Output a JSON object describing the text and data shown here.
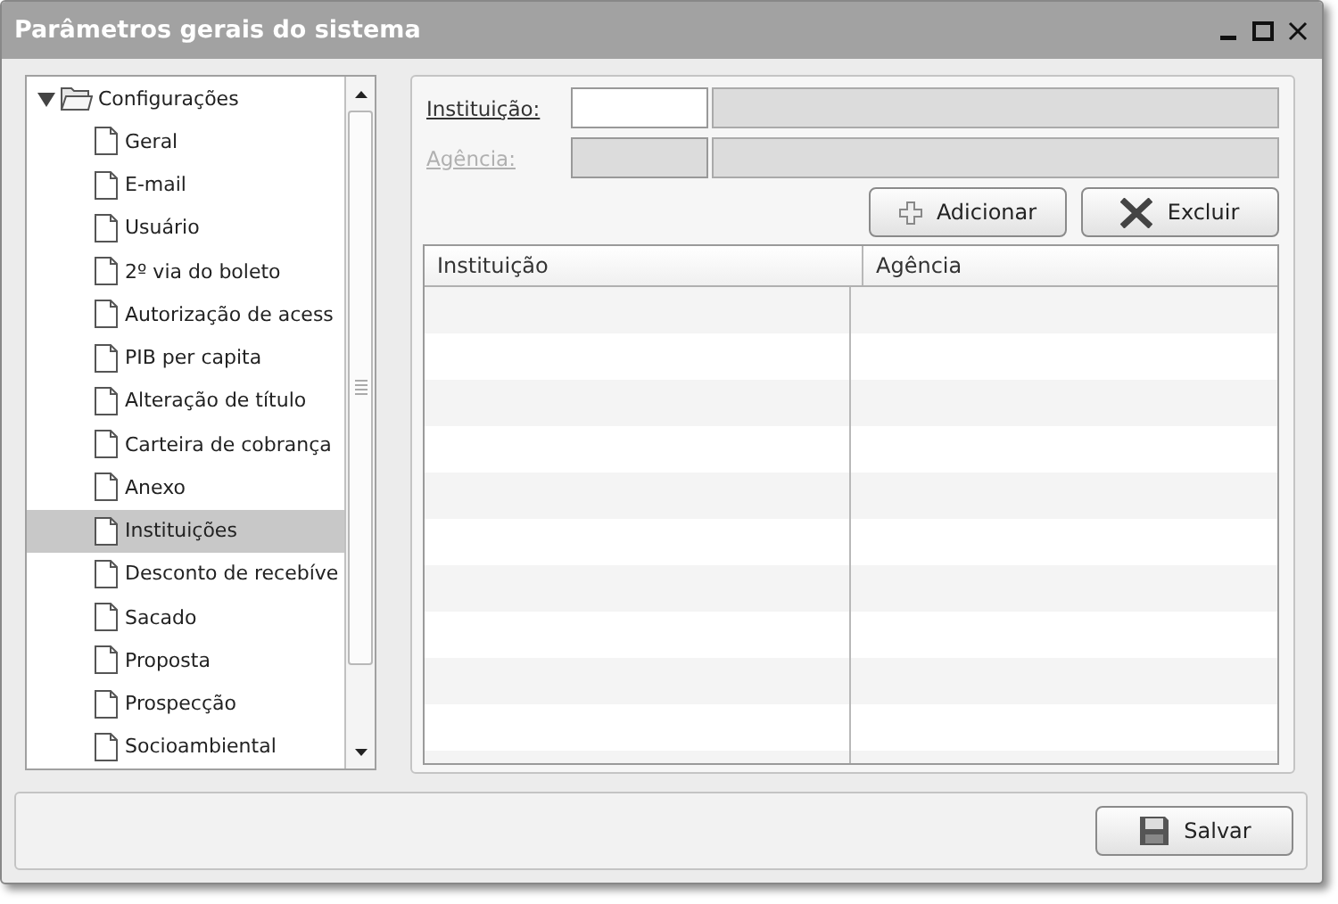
{
  "window": {
    "title": "Parâmetros gerais do sistema"
  },
  "tree": {
    "label": "Configurações",
    "expanded": true,
    "children": [
      {
        "label": "Geral",
        "selected": false
      },
      {
        "label": "E-mail",
        "selected": false
      },
      {
        "label": "Usuário",
        "selected": false
      },
      {
        "label": "2º via do boleto",
        "selected": false
      },
      {
        "label": "Autorização de acess",
        "selected": false
      },
      {
        "label": "PIB per capita",
        "selected": false
      },
      {
        "label": "Alteração de título",
        "selected": false
      },
      {
        "label": "Carteira de cobrança",
        "selected": false
      },
      {
        "label": "Anexo",
        "selected": false
      },
      {
        "label": "Instituições",
        "selected": true
      },
      {
        "label": "Desconto de recebíve",
        "selected": false
      },
      {
        "label": "Sacado",
        "selected": false
      },
      {
        "label": "Proposta",
        "selected": false
      },
      {
        "label": "Prospecção",
        "selected": false
      },
      {
        "label": "Socioambiental",
        "selected": false
      }
    ]
  },
  "form": {
    "fields": [
      {
        "label": "Instituição:",
        "disabled": false
      },
      {
        "label": "Agência:",
        "disabled": true
      }
    ],
    "buttons": [
      {
        "label": "Adicionar",
        "kind": "add"
      },
      {
        "label": "Excluir",
        "kind": "delete"
      }
    ]
  },
  "table": {
    "columns": [
      "Instituição",
      "Agência"
    ]
  },
  "footer": {
    "buttons": [
      {
        "label": "Salvar",
        "kind": "save"
      }
    ]
  }
}
